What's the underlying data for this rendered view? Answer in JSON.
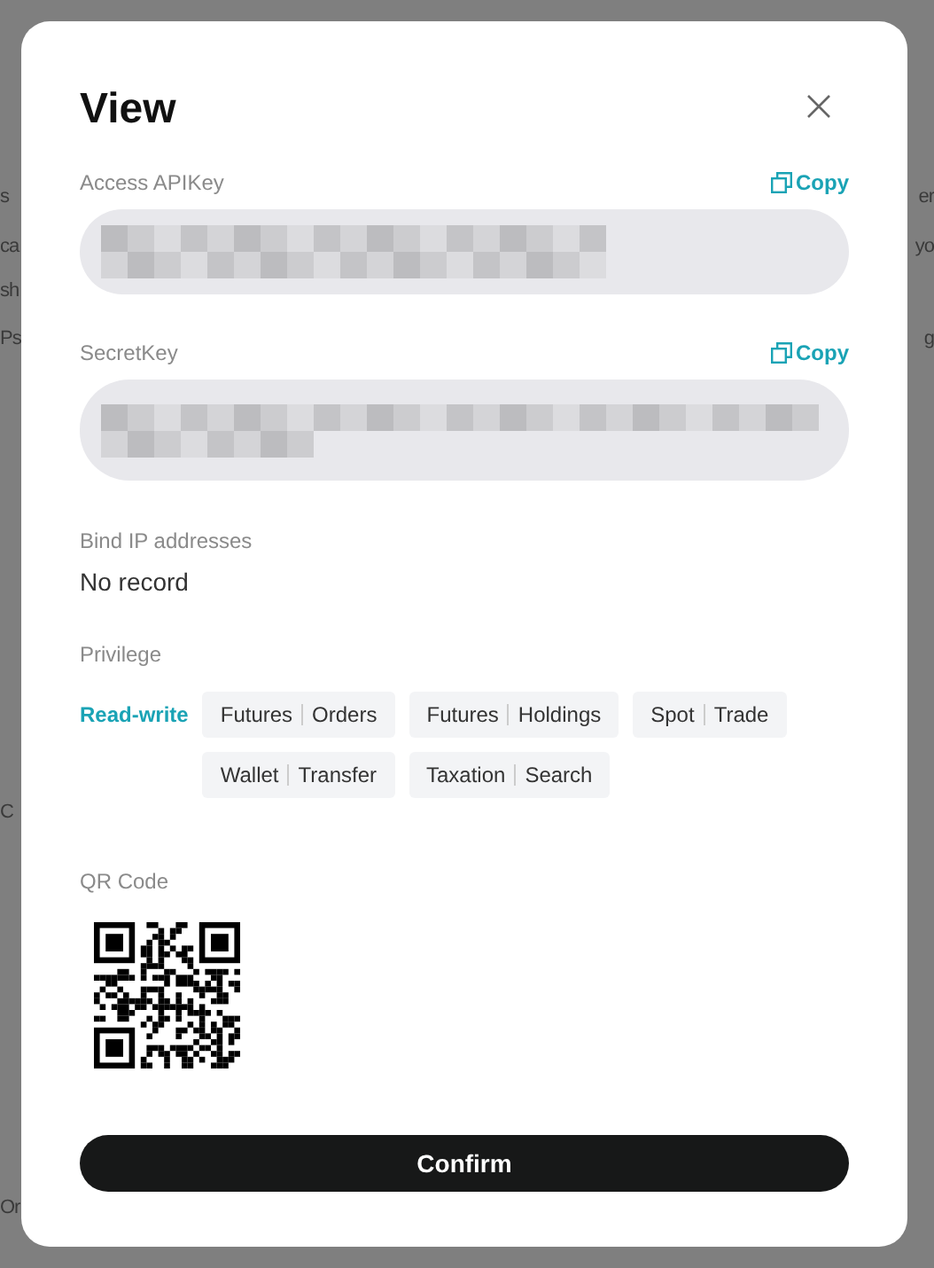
{
  "background": {
    "left_fragments": [
      "s",
      "ca",
      "sh",
      "Ps",
      "C",
      "Or"
    ],
    "right_fragments": [
      "er",
      "yo",
      "g"
    ]
  },
  "dialog": {
    "title": "View",
    "keys": [
      {
        "label": "Access APIKey",
        "copy": "Copy",
        "kind": "short"
      },
      {
        "label": "SecretKey",
        "copy": "Copy",
        "kind": "long"
      }
    ],
    "bind_ip": {
      "label": "Bind IP addresses",
      "value": "No record"
    },
    "privilege": {
      "label": "Privilege",
      "mode": "Read-write",
      "tags": [
        {
          "parts": [
            "Futures",
            "Orders"
          ]
        },
        {
          "parts": [
            "Futures",
            "Holdings"
          ]
        },
        {
          "parts": [
            "Spot",
            "Trade"
          ]
        },
        {
          "parts": [
            "Wallet",
            "Transfer"
          ]
        },
        {
          "parts": [
            "Taxation",
            "Search"
          ]
        }
      ]
    },
    "qr": {
      "label": "QR Code"
    },
    "confirm": "Confirm"
  }
}
